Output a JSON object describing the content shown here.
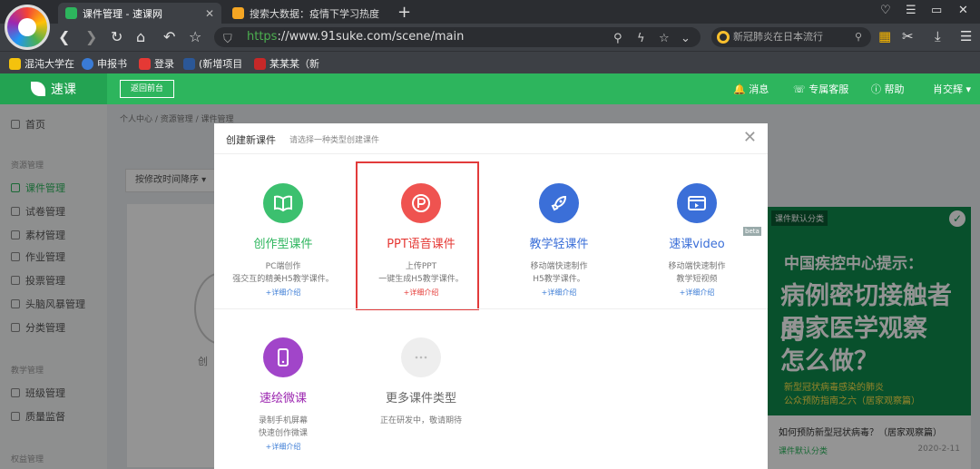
{
  "browser": {
    "tabs": [
      {
        "title": "课件管理 - 速课网",
        "active": true
      },
      {
        "title": "搜索大数据：疫情下学习热度",
        "active": false
      }
    ],
    "url_scheme": "https",
    "url_rest": "://www.91suke.com/scene/main",
    "search_placeholder": "新冠肺炎在日本流行",
    "bookmarks": [
      "混沌大学在",
      "申报书",
      "登录",
      "(新增项目",
      "某某某（新"
    ]
  },
  "header": {
    "logo": "速课",
    "back_label": "返回前台",
    "messages": "消息",
    "support": "专属客服",
    "help": "帮助",
    "user": "肖交辉"
  },
  "sidebar": {
    "home": "首页",
    "section_resources": "资源管理",
    "items": [
      "课件管理",
      "试卷管理",
      "素材管理",
      "作业管理",
      "投票管理",
      "头脑风暴管理",
      "分类管理"
    ],
    "section_teaching": "教学管理",
    "teaching_items": [
      "班级管理",
      "质量监督"
    ],
    "section_other": "权益管理"
  },
  "main": {
    "breadcrumb": "个人中心 / 资源管理 / 课件管理",
    "sort_label": "按修改时间降序",
    "create_text": "创",
    "poster": {
      "tag": "课件默认分类",
      "line1": "中国疾控中心提示：",
      "line2": "病例密切接触者的",
      "line3": "居家医学观察",
      "line4": "怎么做？",
      "line5": "新型冠状病毒感染的肺炎",
      "line6": "公众预防指南之六（居家观察篇）",
      "title": "如何预防新型冠状病毒？（居家观察篇）",
      "category": "课件默认分类",
      "date": "2020-2-11"
    }
  },
  "modal": {
    "title": "创建新课件",
    "subtitle": "请选择一种类型创建课件",
    "types": [
      {
        "name": "创作型课件",
        "desc1": "PC端创作",
        "desc2": "强交互的精美H5教学课件。",
        "more": "+详细介绍",
        "color": "#3cc06f",
        "name_color": "#2db55d",
        "icon": "book-icon"
      },
      {
        "name": "PPT语音课件",
        "desc1": "上传PPT",
        "desc2": "一键生成H5教学课件。",
        "more": "+详细介绍",
        "color": "#ef5350",
        "name_color": "#e53935",
        "icon": "ppt-icon"
      },
      {
        "name": "教学轻课件",
        "desc1": "移动端快速制作",
        "desc2": "H5教学课件。",
        "more": "+详细介绍",
        "color": "#3b6fd8",
        "name_color": "#3b6fd8",
        "icon": "rocket-icon"
      },
      {
        "name": "速课video",
        "desc1": "移动端快速制作",
        "desc2": "教学短视频",
        "more": "+详细介绍",
        "color": "#3b6fd8",
        "name_color": "#3b6fd8",
        "icon": "video-icon"
      },
      {
        "name": "速绘微课",
        "desc1": "录制手机屏幕",
        "desc2": "快速创作微课",
        "more": "+详细介绍",
        "color": "#a145c9",
        "name_color": "#9c27b0",
        "icon": "phone-icon"
      },
      {
        "name": "更多课件类型",
        "desc1": "正在研发中，敬请期待",
        "desc2": "",
        "more": "",
        "color": "#eeeeee",
        "name_color": "#666666",
        "icon": "more-icon"
      }
    ],
    "beta": "beta"
  }
}
